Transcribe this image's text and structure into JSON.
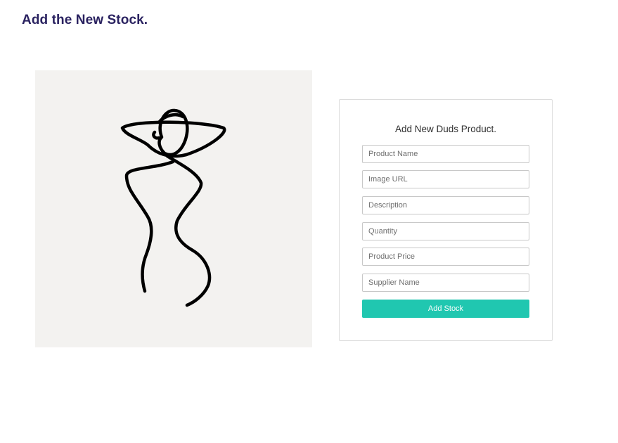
{
  "page": {
    "title": "Add the New Stock."
  },
  "illustration": {
    "icon": "line-art-woman-with-hat-icon",
    "background_color": "#f3f2f0"
  },
  "form": {
    "heading": "Add New Duds Product.",
    "fields": [
      {
        "name": "product-name",
        "placeholder": "Product Name",
        "value": ""
      },
      {
        "name": "image-url",
        "placeholder": "Image URL",
        "value": ""
      },
      {
        "name": "description",
        "placeholder": "Description",
        "value": ""
      },
      {
        "name": "quantity",
        "placeholder": "Quantity",
        "value": ""
      },
      {
        "name": "product-price",
        "placeholder": "Product Price",
        "value": ""
      },
      {
        "name": "supplier-name",
        "placeholder": "Supplier Name",
        "value": ""
      }
    ],
    "submit_label": "Add Stock"
  },
  "colors": {
    "title": "#2a2260",
    "accent": "#20c7b0",
    "card_border": "#dcdcdc"
  }
}
